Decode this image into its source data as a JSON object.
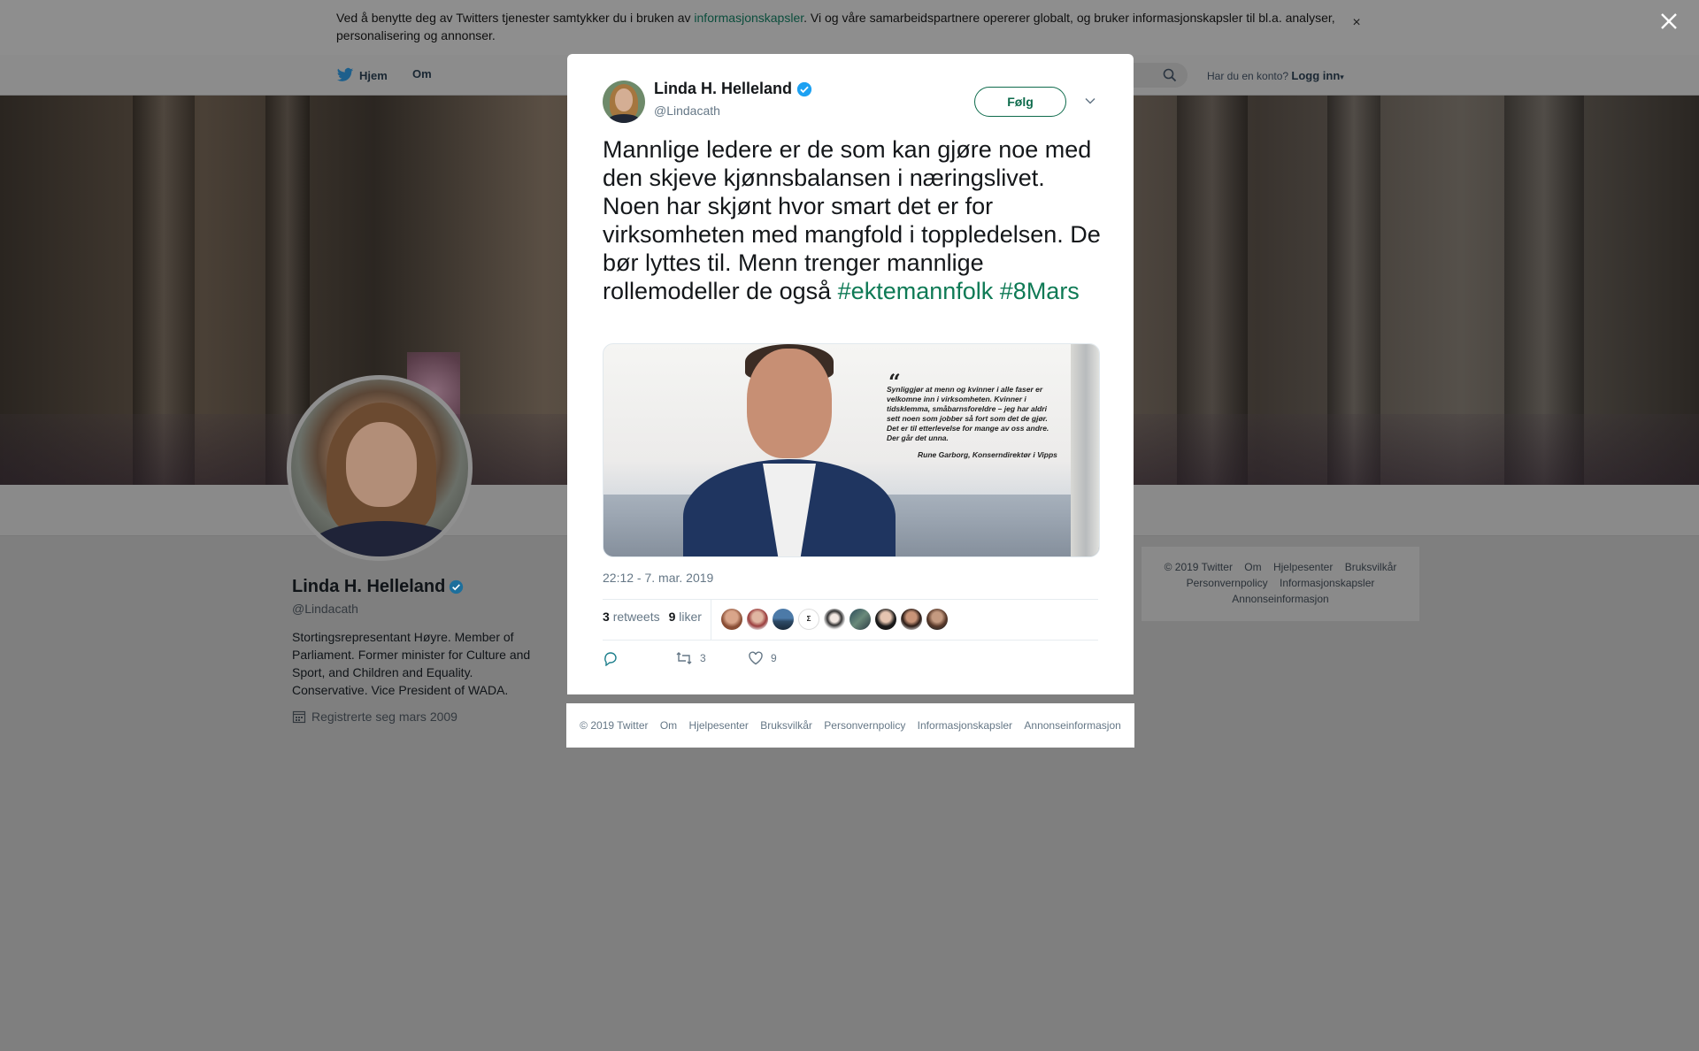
{
  "cookie_bar": {
    "text_before": "Ved å benytte deg av Twitters tjenester samtykker du i bruken av ",
    "link": "informasjonskapsler",
    "text_after": ". Vi og våre samarbeidspartnere opererer globalt, og bruker informasjonskapsler til bl.a. analyser, personalisering og annonser.",
    "close": "×"
  },
  "nav": {
    "home": "Hjem",
    "about": "Om",
    "account_prompt": "Har du en konto?",
    "login": "Logg inn"
  },
  "profile": {
    "name": "Linda H. Helleland",
    "handle": "@Lindacath",
    "bio": "Stortingsrepresentant Høyre. Member of Parliament. Former minister for Culture and Sport, and Children and Equality. Conservative. Vice President of WADA.",
    "joined": "Registrerte seg mars 2009"
  },
  "side_footer": {
    "items": [
      "© 2019 Twitter",
      "Om",
      "Hjelpesenter",
      "Bruksvilkår",
      "Personvernpolicy",
      "Informasjonskapsler",
      "Annonseinformasjon"
    ]
  },
  "tweet": {
    "author_name": "Linda H. Helleland",
    "author_handle": "@Lindacath",
    "follow_label": "Følg",
    "text_line1": "Mannlige ledere er de som kan gjøre noe med den skjeve kjønnsbalansen i næringslivet.",
    "text_line2": "Noen har skjønt hvor smart det er for virksomheten med mangfold i toppledelsen. De bør lyttes til. Menn trenger mannlige rollemodeller de også ",
    "hashtags": [
      "#ektemannfolk",
      "#8Mars"
    ],
    "media": {
      "quote_mark": "“",
      "quote": "Synliggjør at menn og kvinner i alle faser er velkomne inn i virksomheten. Kvinner i tidsklemma, småbarnsforeldre – jeg har aldri sett noen som jobber så fort som det de gjør. Det er til etterlevelse for mange av oss andre. Der går det unna.",
      "author": "Rune Garborg, Konserndirektør i Vipps"
    },
    "timestamp": "22:12 - 7. mar. 2019",
    "retweets_count": "3",
    "retweets_label": "retweets",
    "likes_count": "9",
    "likes_label": "liker",
    "action_retweet_count": "3",
    "action_like_count": "9"
  },
  "modal_footer": {
    "items": [
      "© 2019 Twitter",
      "Om",
      "Hjelpesenter",
      "Bruksvilkår",
      "Personvernpolicy",
      "Informasjonskapsler",
      "Annonseinformasjon"
    ]
  },
  "colors": {
    "accent": "#0e7a55",
    "verified": "#1da1f2",
    "overlay": "#7f7f7f"
  },
  "icons": [
    "twitter-bird-icon",
    "search-icon",
    "verified-icon",
    "calendar-icon",
    "chevron-down-icon",
    "reply-icon",
    "retweet-icon",
    "like-icon",
    "close-icon"
  ]
}
